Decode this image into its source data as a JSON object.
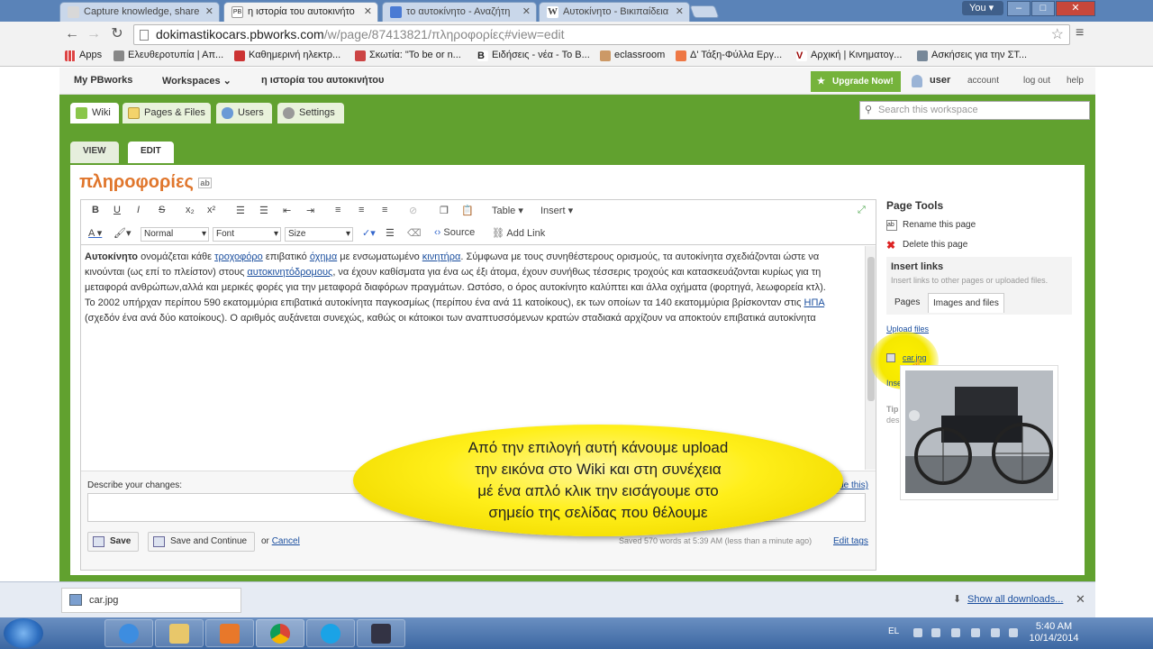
{
  "browser": {
    "tabs": [
      {
        "title": "Capture knowledge, share",
        "color": "#d8d8d8"
      },
      {
        "title": "η ιστορία του αυτοκινήτο",
        "color": "#ffffff"
      },
      {
        "title": "το αυτοκίνητο - Αναζήτη",
        "color": "#4a7bd4"
      },
      {
        "title": "Αυτοκίνητο - Βικιπαίδεια",
        "color": "#ffffff"
      }
    ],
    "user_button": "You",
    "url_host": "dokimastikocars.pbworks.com",
    "url_path": "/w/page/87413821/πληροφορίες#view=edit",
    "bookmarks": [
      {
        "label": "Apps",
        "color": "#d44"
      },
      {
        "label": "Ελευθεροτυπία | Απ...",
        "color": "#888"
      },
      {
        "label": "Καθημερινή ηλεκτρ...",
        "color": "#c33"
      },
      {
        "label": "Σκωτία: \"To be or n...",
        "color": "#c44"
      },
      {
        "label": "Ειδήσεις - νέα - Το Β...",
        "color": "#222"
      },
      {
        "label": "eclassroom",
        "color": "#c96"
      },
      {
        "label": "Δ' Τάξη-Φύλλα Εργ...",
        "color": "#e74"
      },
      {
        "label": "Αρχική | Κινηματογ...",
        "color": "#900"
      },
      {
        "label": "Ασκήσεις για την ΣΤ...",
        "color": "#789"
      }
    ]
  },
  "pbworks": {
    "topbar": {
      "my": "My PBworks",
      "workspaces": "Workspaces",
      "workspace_name": "η ιστορία του αυτοκινήτου",
      "upgrade": "Upgrade Now!",
      "user": "user",
      "account": "account",
      "logout": "log out",
      "help": "help"
    },
    "tabs": [
      "Wiki",
      "Pages & Files",
      "Users",
      "Settings"
    ],
    "search_placeholder": "Search this workspace",
    "view_tab": "VIEW",
    "edit_tab": "EDIT",
    "page_title": "πληροφορίες",
    "editor": {
      "table": "Table",
      "insert": "Insert",
      "style": "Normal",
      "font": "Font",
      "size": "Size",
      "source": "Source",
      "add_link": "Add Link",
      "p1_word1": "Αυτοκίνητο",
      "p1_a": " ονομάζεται κάθε ",
      "link_trochoforo": "τροχοφόρο",
      "p1_b": " επιβατικό ",
      "link_ochima": "όχημα",
      "p1_c": " με ενσωματωμένο ",
      "link_kinitira": "κινητήρα",
      "p1_d": ". Σύμφωνα με τους συνηθέστερους ορισμούς, τα αυτοκίνητα σχεδιάζονται ώστε να κινούνται (ως επί το πλείστον) στους ",
      "link_dromous": "αυτοκινητόδρομους",
      "p1_e": ", να έχουν καθίσματα για ένα ως έξι άτομα, έχουν συνήθως τέσσερις τροχούς και κατασκευάζονται κυρίως για τη μεταφορά ανθρώπων,αλλά και μερικές φορές για την μεταφορά διαφόρων πραγμάτων. Ωστόσο, ο όρος αυτοκίνητο καλύπτει και άλλα οχήματα (φορτηγά, λεωφορεία κτλ).",
      "p2_a": "Το 2002 υπήρχαν περίπου 590 εκατομμύρια επιβατικά αυτοκίνητα παγκοσμίως (περίπου ένα ανά 11 κατοίκους), εκ των οποίων τα 140 εκατομμύρια βρίσκονταν στις ",
      "link_ipa": "ΗΠΑ",
      "p2_b": " (σχεδόν ένα ανά δύο κατοίκους). Ο αριθμός αυξάνεται συνεχώς, καθώς οι κάτοικοι των αναπτυσσόμενων κρατών σταδιακά αρχίζουν να αποκτούν επιβατικά αυτοκίνητα"
    },
    "describe_label": "Describe your changes:",
    "hide_this": "(hide this)",
    "save": "Save",
    "save_continue": "Save and Continue",
    "or": "or",
    "cancel": "Cancel",
    "saved_status": "Saved 570 words at 5:39 AM (less than a minute ago)",
    "edit_tags": "Edit tags",
    "page_tools": {
      "title": "Page Tools",
      "rename": "Rename this page",
      "delete": "Delete this page"
    },
    "insert_links": {
      "title": "Insert links",
      "sub": "Insert links to other pages or uploaded files.",
      "tab_pages": "Pages",
      "tab_images": "Images and files",
      "upload": "Upload files",
      "file": "car.jpg",
      "insert_prefix": "Inse",
      "tip_prefix": "Tip",
      "tip_line": "des"
    },
    "callout": [
      "Από την επιλογή αυτή κάνουμε upload",
      "την εικόνα στο Wiki και στη συνέχεια",
      "μέ ένα απλό κλικ την εισάγουμε στο",
      "σημείο της σελίδας που θέλουμε"
    ]
  },
  "downloads": {
    "file": "car.jpg",
    "show_all": "Show all downloads..."
  },
  "taskbar": {
    "lang": "EL",
    "time": "5:40 AM",
    "date": "10/14/2014"
  }
}
